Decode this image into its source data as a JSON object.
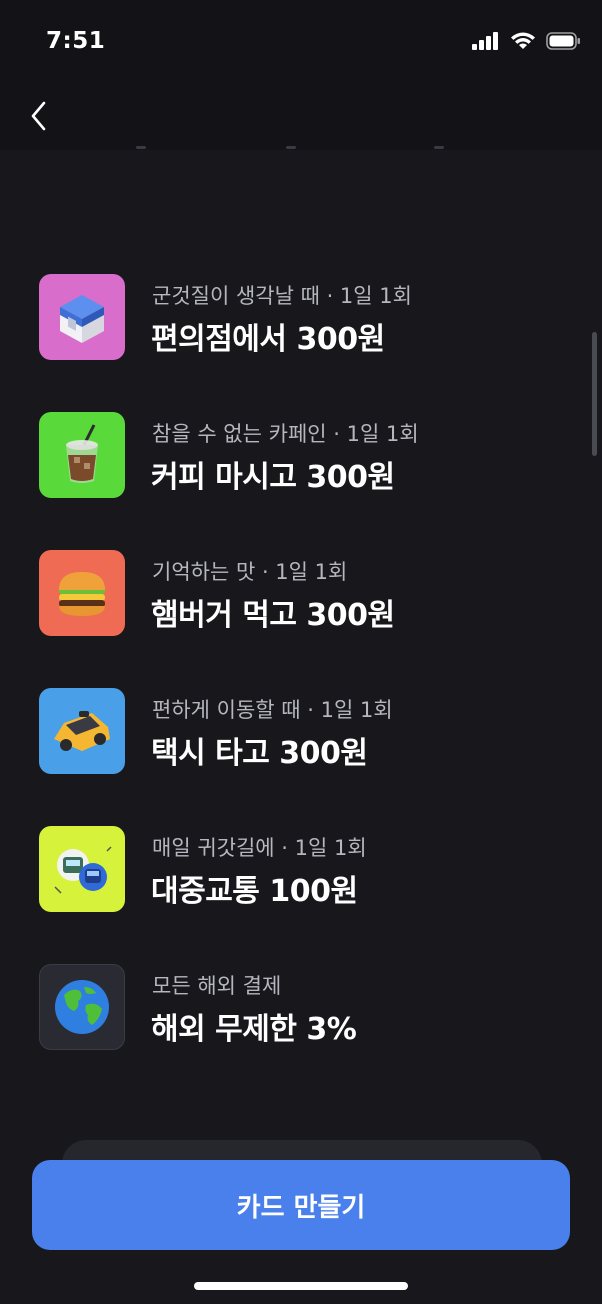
{
  "status_bar": {
    "time": "7:51"
  },
  "header": {
    "back_icon": "chevron-left-icon"
  },
  "benefits": [
    {
      "subtitle": "군것질이 생각날 때 · 1일 1회",
      "title": "편의점에서 300원",
      "icon": "convenience-store-icon",
      "bg": "#d96dcc"
    },
    {
      "subtitle": "참을 수 없는 카페인 · 1일 1회",
      "title": "커피 마시고 300원",
      "icon": "iced-coffee-icon",
      "bg": "#59d93a"
    },
    {
      "subtitle": "기억하는 맛 · 1일 1회",
      "title": "햄버거 먹고 300원",
      "icon": "hamburger-icon",
      "bg": "#ef6b53"
    },
    {
      "subtitle": "편하게 이동할 때 · 1일 1회",
      "title": "택시 타고 300원",
      "icon": "taxi-icon",
      "bg": "#4aa0e8"
    },
    {
      "subtitle": "매일 귀갓길에 · 1일 1회",
      "title": "대중교통 100원",
      "icon": "public-transport-icon",
      "bg": "#d6f23a"
    },
    {
      "subtitle": "모든 해외 결제",
      "title": "해외 무제한 3%",
      "icon": "globe-icon",
      "bg": "#2a2b32"
    }
  ],
  "cta": {
    "label": "카드 만들기",
    "color": "#4a80eb"
  }
}
